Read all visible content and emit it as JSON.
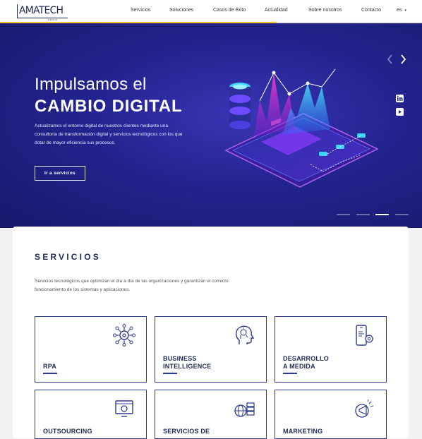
{
  "header": {
    "logo_text": "AMATECH",
    "logo_sub": "GROUP",
    "nav": [
      "Servicios",
      "Soluciones",
      "Casos de éxito",
      "Actualidad",
      "Sobre nosotros",
      "Contacto"
    ],
    "language": "es"
  },
  "hero": {
    "title_line1": "Impulsamos el",
    "title_line2": "CAMBIO DIGITAL",
    "description": "Actualizamos el entorno digital de nuestros clientes mediante una consultoría de transformación digital y servicios tecnológicos con los que dotar de mayor eficiencia sus procesos.",
    "button_label": "Ir a servicios",
    "prev_icon": "chevron-left-icon",
    "next_icon": "chevron-right-icon",
    "social": [
      "linkedin-icon",
      "youtube-icon"
    ],
    "slides": {
      "count": 4,
      "active": 3
    }
  },
  "services": {
    "title": "SERVICIOS",
    "description": "Servicios tecnológicos que optimizan el día a día de las organizaciones y garantizan el correcto funcionamiento de los sistemas y aplicaciones.",
    "tiles": [
      {
        "label": "RPA",
        "icon": "automation-gear-icon"
      },
      {
        "label": "BUSINESS\nINTELLIGENCE",
        "icon": "brain-head-icon"
      },
      {
        "label": "DESARROLLO\nA MEDIDA",
        "icon": "mobile-gear-icon"
      },
      {
        "label": "OUTSOURCING",
        "icon": "monitor-gear-icon"
      },
      {
        "label": "SERVICIOS DE",
        "icon": "server-network-icon"
      },
      {
        "label": "MARKETING",
        "icon": "megaphone-icon"
      }
    ]
  },
  "colors": {
    "brand": "#1f2a55",
    "accent": "#f0c52b",
    "tile_border": "#2b3a8c",
    "hero_bg": "#23238f"
  }
}
